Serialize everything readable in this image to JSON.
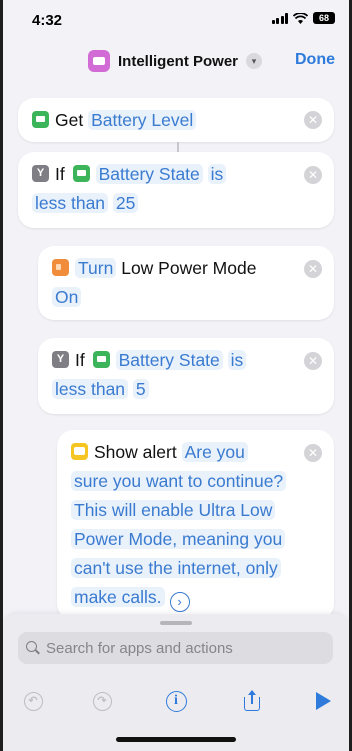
{
  "status_bar": {
    "time": "4:32",
    "battery": "68"
  },
  "nav": {
    "title": "Intelligent Power",
    "done_label": "Done"
  },
  "actions": {
    "get": {
      "keyword": "Get",
      "param": "Battery Level"
    },
    "if1": {
      "keyword": "If",
      "variable": "Battery State",
      "op_is": "is",
      "op_rest": "less than",
      "value": "25"
    },
    "turn": {
      "keyword": "Turn",
      "label": "Low Power Mode",
      "state": "On"
    },
    "if2": {
      "keyword": "If",
      "variable": "Battery State",
      "op_is": "is",
      "op_rest": "less than",
      "value": "5"
    },
    "alert": {
      "keyword": "Show alert",
      "message_first": "Are you",
      "message_lines": [
        "sure you want to continue?",
        "This will enable Ultra Low",
        "Power Mode, meaning you",
        "can't use the internet, only",
        "make calls."
      ]
    }
  },
  "search": {
    "placeholder": "Search for apps and actions",
    "value": ""
  },
  "colors": {
    "accent": "#2f7bdc",
    "app_icon": "#d26bd6",
    "battery_action": "#3cb45a",
    "scripting_action": "#7e7e84",
    "low_power_action": "#f08c3a",
    "alert_action": "#f5c623"
  },
  "icons": {
    "app": "battery-icon",
    "get": "battery-icon",
    "if": "branch-icon",
    "turn": "low-battery-icon",
    "alert": "message-icon",
    "toolbar": [
      "undo-icon",
      "redo-icon",
      "info-icon",
      "share-icon",
      "play-icon"
    ]
  }
}
